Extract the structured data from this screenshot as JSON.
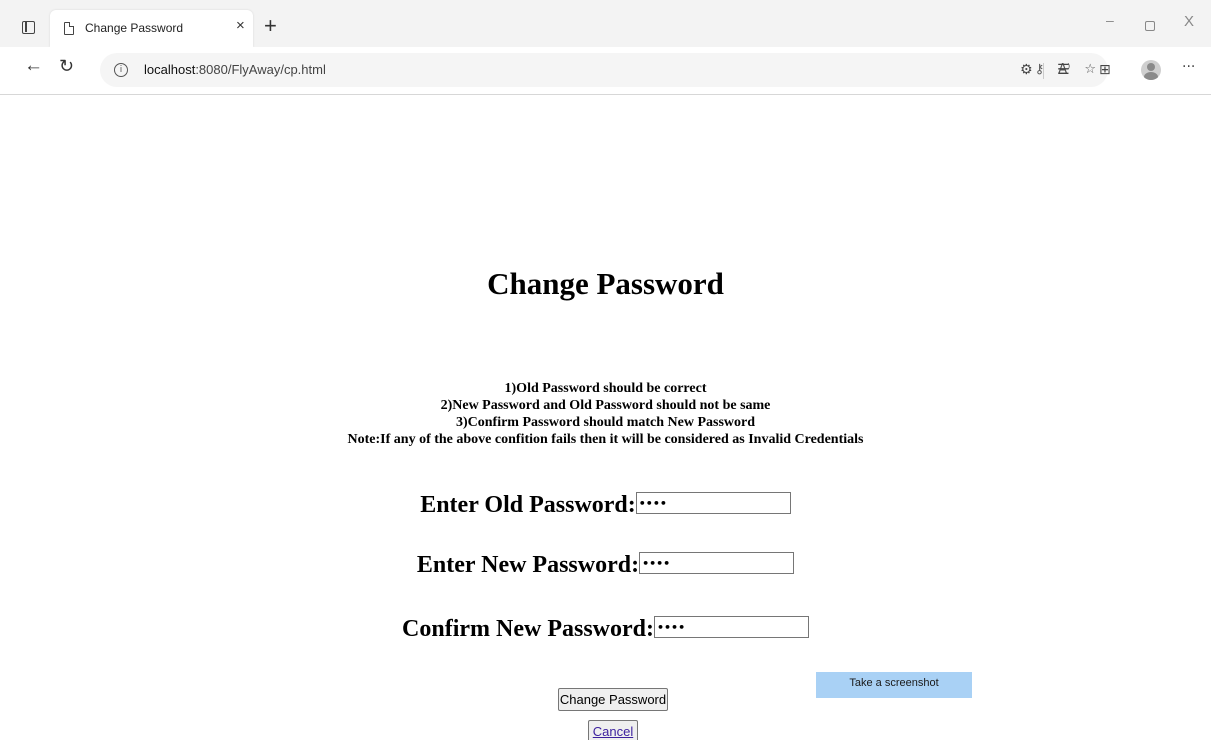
{
  "browser": {
    "tab": {
      "title": "Change Password",
      "close_glyph": "×"
    },
    "new_tab_glyph": "+",
    "window_controls": {
      "minimize": "–",
      "close": "X"
    },
    "address": {
      "host": "localhost",
      "path": ":8080/FlyAway/cp.html"
    },
    "nav": {
      "back_glyph": "←",
      "reload_glyph": "↻"
    },
    "toolbar_icons": {
      "read_aloud": "A⁾",
      "more": "···"
    }
  },
  "page": {
    "title": "Change Password",
    "rules": [
      "1)Old Password should be correct",
      "2)New Password and Old Password should not be same",
      "3)Confirm Password should match New Password",
      "Note:If any of the above confition fails then it will be considered as Invalid Credentials"
    ],
    "fields": {
      "old": {
        "label": "Enter Old Password:",
        "value": "••••"
      },
      "new": {
        "label": "Enter New Password:",
        "value": "••••"
      },
      "confirm": {
        "label": "Confirm New Password:",
        "value": "••••"
      }
    },
    "submit_label": "Change Password",
    "cancel_label": "Cancel",
    "screenshot_tip": "Take a screenshot"
  }
}
